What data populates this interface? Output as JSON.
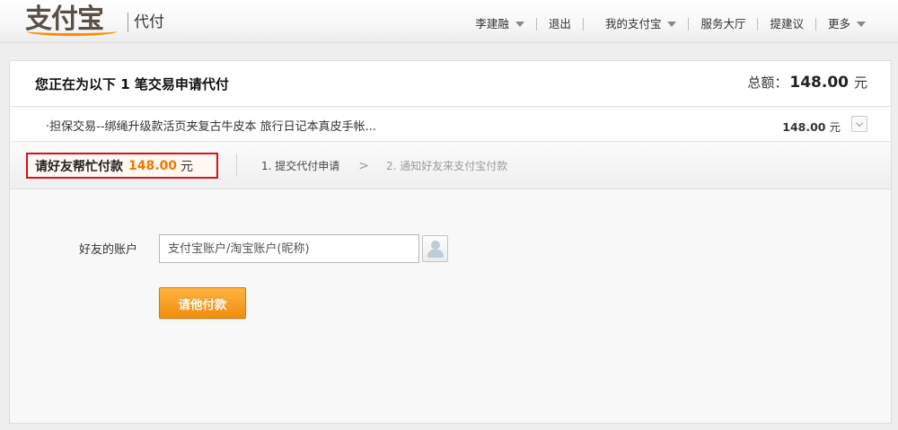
{
  "header": {
    "logo_text": "支付宝",
    "product_name": "代付",
    "nav": [
      {
        "label": "李建融",
        "has_dropdown": true
      },
      {
        "label": "退出",
        "has_dropdown": false
      },
      {
        "label": "我的支付宝",
        "has_dropdown": true
      },
      {
        "label": "服务大厅",
        "has_dropdown": false
      },
      {
        "label": "提建议",
        "has_dropdown": false
      },
      {
        "label": "更多",
        "has_dropdown": true
      }
    ]
  },
  "summary": {
    "title": "您正在为以下 1 笔交易申请代付",
    "total_label": "总额：",
    "total_amount": "148.00",
    "currency": "元"
  },
  "item": {
    "name": "·担保交易--绑绳升级款活页夹复古牛皮本 旅行日记本真皮手帐...",
    "price": "148.00",
    "currency": "元"
  },
  "request": {
    "label": "请好友帮忙付款",
    "amount": "148.00",
    "currency": "元"
  },
  "steps": [
    {
      "label": "1. 提交代付申请",
      "active": true
    },
    {
      "label": "2. 通知好友来支付宝付款",
      "active": false
    }
  ],
  "step_arrow": ">",
  "form": {
    "account_label": "好友的账户",
    "account_placeholder": "支付宝账户/淘宝账户(昵称)",
    "account_value": "",
    "submit_label": "请他付款"
  },
  "colors": {
    "accent_orange": "#f07800",
    "highlight_border": "#d5121b",
    "button_orange": "#f39a1f"
  }
}
